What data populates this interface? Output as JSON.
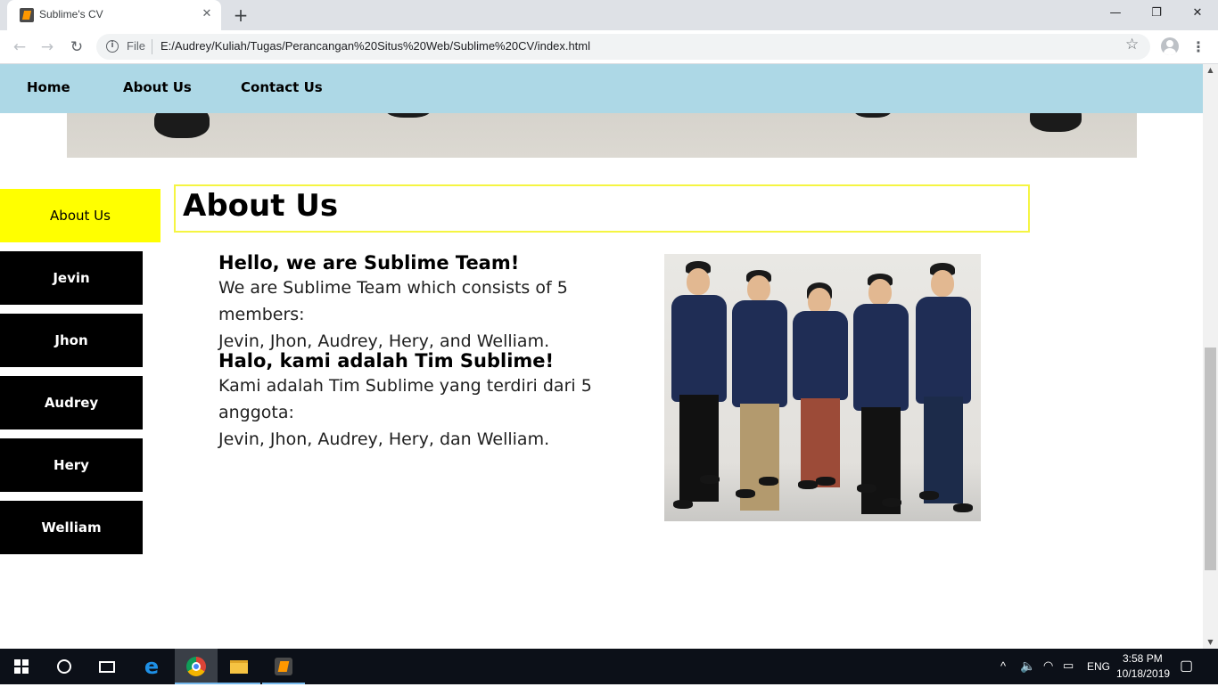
{
  "browser": {
    "tab_title": "Sublime's CV",
    "tab_close": "✕",
    "new_tab": "+",
    "minimize": "—",
    "restore": "❐",
    "close": "✕",
    "back": "←",
    "forward": "→",
    "reload": "↻",
    "info": "i",
    "file_label": "File",
    "url": "E:/Audrey/Kuliah/Tugas/Perancangan%20Situs%20Web/Sublime%20CV/index.html",
    "star": "☆",
    "menu": "⋮"
  },
  "site_nav": {
    "items": [
      {
        "label": "Home"
      },
      {
        "label": "About Us"
      },
      {
        "label": "Contact Us"
      }
    ]
  },
  "sidebar": {
    "items": [
      {
        "label": "About Us",
        "active": true
      },
      {
        "label": "Jevin"
      },
      {
        "label": "Jhon"
      },
      {
        "label": "Audrey"
      },
      {
        "label": "Hery"
      },
      {
        "label": "Welliam"
      }
    ]
  },
  "main": {
    "heading": "About Us",
    "english": {
      "title": "Hello, we are Sublime Team!",
      "line1": "We are Sublime Team which consists of 5 members:",
      "line2": "Jevin, Jhon, Audrey, Hery, and Welliam."
    },
    "indonesian": {
      "title": "Halo, kami adalah Tim Sublime!",
      "line1": "Kami adalah Tim Sublime yang terdiri dari 5 anggota:",
      "line2": "Jevin, Jhon, Audrey, Hery, dan Welliam."
    }
  },
  "taskbar": {
    "language": "ENG",
    "time": "3:58 PM",
    "date": "10/18/2019"
  },
  "colors": {
    "nav_bg": "#add8e6",
    "active_sidebar": "#ffff00",
    "sidebar_bg": "#000000",
    "heading_border": "#f5f542"
  }
}
